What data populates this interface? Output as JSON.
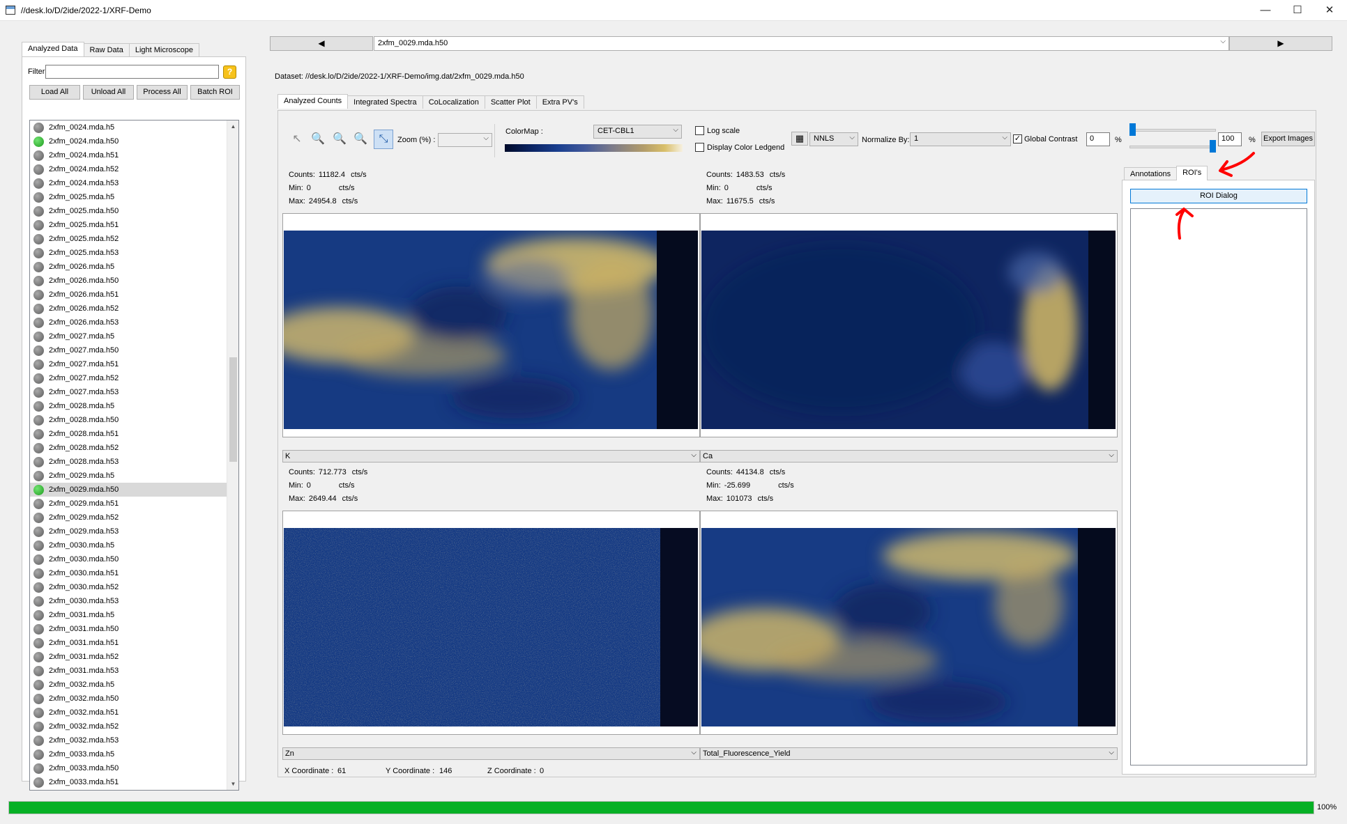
{
  "window": {
    "title": "//desk.lo/D/2ide/2022-1/XRF-Demo",
    "minimize": "—",
    "maximize": "☐",
    "close": "✕"
  },
  "left": {
    "tabs": [
      "Analyzed Data",
      "Raw Data",
      "Light Microscope"
    ],
    "filter_label": "Filter",
    "filter_value": "",
    "buttons": [
      "Load All",
      "Unload All",
      "Process All",
      "Batch ROI"
    ],
    "files": [
      {
        "name": "2xfm_0024.mda.h5",
        "status": "gray"
      },
      {
        "name": "2xfm_0024.mda.h50",
        "status": "green"
      },
      {
        "name": "2xfm_0024.mda.h51",
        "status": "gray"
      },
      {
        "name": "2xfm_0024.mda.h52",
        "status": "gray"
      },
      {
        "name": "2xfm_0024.mda.h53",
        "status": "gray"
      },
      {
        "name": "2xfm_0025.mda.h5",
        "status": "gray"
      },
      {
        "name": "2xfm_0025.mda.h50",
        "status": "gray"
      },
      {
        "name": "2xfm_0025.mda.h51",
        "status": "gray"
      },
      {
        "name": "2xfm_0025.mda.h52",
        "status": "gray"
      },
      {
        "name": "2xfm_0025.mda.h53",
        "status": "gray"
      },
      {
        "name": "2xfm_0026.mda.h5",
        "status": "gray"
      },
      {
        "name": "2xfm_0026.mda.h50",
        "status": "gray"
      },
      {
        "name": "2xfm_0026.mda.h51",
        "status": "gray"
      },
      {
        "name": "2xfm_0026.mda.h52",
        "status": "gray"
      },
      {
        "name": "2xfm_0026.mda.h53",
        "status": "gray"
      },
      {
        "name": "2xfm_0027.mda.h5",
        "status": "gray"
      },
      {
        "name": "2xfm_0027.mda.h50",
        "status": "gray"
      },
      {
        "name": "2xfm_0027.mda.h51",
        "status": "gray"
      },
      {
        "name": "2xfm_0027.mda.h52",
        "status": "gray"
      },
      {
        "name": "2xfm_0027.mda.h53",
        "status": "gray"
      },
      {
        "name": "2xfm_0028.mda.h5",
        "status": "gray"
      },
      {
        "name": "2xfm_0028.mda.h50",
        "status": "gray"
      },
      {
        "name": "2xfm_0028.mda.h51",
        "status": "gray"
      },
      {
        "name": "2xfm_0028.mda.h52",
        "status": "gray"
      },
      {
        "name": "2xfm_0028.mda.h53",
        "status": "gray"
      },
      {
        "name": "2xfm_0029.mda.h5",
        "status": "gray"
      },
      {
        "name": "2xfm_0029.mda.h50",
        "status": "green",
        "selected": true
      },
      {
        "name": "2xfm_0029.mda.h51",
        "status": "gray"
      },
      {
        "name": "2xfm_0029.mda.h52",
        "status": "gray"
      },
      {
        "name": "2xfm_0029.mda.h53",
        "status": "gray"
      },
      {
        "name": "2xfm_0030.mda.h5",
        "status": "gray"
      },
      {
        "name": "2xfm_0030.mda.h50",
        "status": "gray"
      },
      {
        "name": "2xfm_0030.mda.h51",
        "status": "gray"
      },
      {
        "name": "2xfm_0030.mda.h52",
        "status": "gray"
      },
      {
        "name": "2xfm_0030.mda.h53",
        "status": "gray"
      },
      {
        "name": "2xfm_0031.mda.h5",
        "status": "gray"
      },
      {
        "name": "2xfm_0031.mda.h50",
        "status": "gray"
      },
      {
        "name": "2xfm_0031.mda.h51",
        "status": "gray"
      },
      {
        "name": "2xfm_0031.mda.h52",
        "status": "gray"
      },
      {
        "name": "2xfm_0031.mda.h53",
        "status": "gray"
      },
      {
        "name": "2xfm_0032.mda.h5",
        "status": "gray"
      },
      {
        "name": "2xfm_0032.mda.h50",
        "status": "gray"
      },
      {
        "name": "2xfm_0032.mda.h51",
        "status": "gray"
      },
      {
        "name": "2xfm_0032.mda.h52",
        "status": "gray"
      },
      {
        "name": "2xfm_0032.mda.h53",
        "status": "gray"
      },
      {
        "name": "2xfm_0033.mda.h5",
        "status": "gray"
      },
      {
        "name": "2xfm_0033.mda.h50",
        "status": "gray"
      },
      {
        "name": "2xfm_0033.mda.h51",
        "status": "gray"
      }
    ]
  },
  "nav": {
    "prev": "◀",
    "next": "▶",
    "current_file": "2xfm_0029.mda.h50"
  },
  "dataset_label": "Dataset: //desk.lo/D/2ide/2022-1/XRF-Demo/img.dat/2xfm_0029.mda.h50",
  "main_tabs": [
    "Analyzed Counts",
    "Integrated Spectra",
    "CoLocalization",
    "Scatter Plot",
    "Extra PV's"
  ],
  "toolbar": {
    "zoom_label": "Zoom (%) :",
    "zoom_value": "",
    "colormap_label": "ColorMap :",
    "colormap_value": "CET-CBL1",
    "log_scale": "Log scale",
    "display_legend": "Display Color Ledgend",
    "fit_method": "NNLS",
    "normalize_label": "Normalize By:",
    "normalize_value": "1",
    "global_contrast": "Global Contrast",
    "min_value": "0",
    "max_value": "100",
    "pct1": "%",
    "pct2": "%",
    "export": "Export Images",
    "contrast_min_fraction": 0.0,
    "contrast_max_fraction": 1.0
  },
  "panes": [
    {
      "counts": "11182.4",
      "min": "0",
      "max": "24954.8",
      "unit": "cts/s",
      "element": "K"
    },
    {
      "counts": "1483.53",
      "min": "0",
      "max": "11675.5",
      "unit": "cts/s",
      "element": "Ca"
    },
    {
      "counts": "712.773",
      "min": "0",
      "max": "2649.44",
      "unit": "cts/s",
      "element": "Zn"
    },
    {
      "counts": "44134.8",
      "min": "-25.699",
      "max": "101073",
      "unit": "cts/s",
      "element": "Total_Fluorescence_Yield"
    }
  ],
  "labels": {
    "counts": "Counts:",
    "min": "Min:",
    "max": "Max:"
  },
  "coords": {
    "x_label": "X Coordinate :",
    "x_value": "61",
    "y_label": "Y Coordinate :",
    "y_value": "146",
    "z_label": "Z Coordinate :",
    "z_value": "0"
  },
  "right": {
    "tabs": [
      "Annotations",
      "ROI's"
    ],
    "roi_dialog": "ROI Dialog"
  },
  "progress": {
    "value": 1.0,
    "label": "100%"
  },
  "colors": {
    "accent": "#0078d7",
    "progress": "#06b025",
    "annotation": "#ff0000"
  }
}
